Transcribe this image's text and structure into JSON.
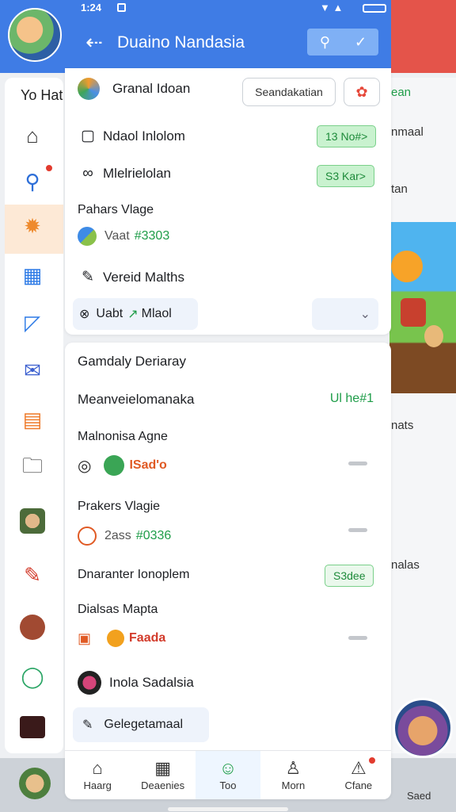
{
  "status_bar": {
    "time": "1:24"
  },
  "background": {
    "sidebar_title": "Yo Hat",
    "right_texts": [
      "ean",
      "nmaal",
      "tan",
      "nats",
      "nalas"
    ],
    "bottom_right_label": "Saed"
  },
  "header": {
    "title": "Duaino Nandasia"
  },
  "top_row": {
    "title": "Granal Idoan",
    "button": "Seandakatian"
  },
  "card1": {
    "row1": {
      "label": "Ndaol Inlolom",
      "pill": "13 No#>"
    },
    "row2": {
      "label": "Mlelrielolan",
      "pill": "S3 Kar>"
    },
    "section": "Pahars Vlage",
    "value": {
      "prefix": "Vaat",
      "num": "#3303"
    },
    "row3": {
      "label": "Vereid Malths"
    },
    "chip": {
      "text1": "Uabt",
      "text2": "Mlaol"
    }
  },
  "card2": {
    "title": "Gamdaly Deriaray",
    "row1": {
      "label": "Meanveielomanaka",
      "value": "Ul he#1"
    },
    "sec1": {
      "label": "Malnonisa Agne",
      "value": "ISad'o"
    },
    "sec2": {
      "label": "Prakers Vlagie",
      "value_a": "2ass",
      "value_b": "#0336"
    },
    "row2": {
      "label": "Dnaranter Ionoplem",
      "pill": "S3dee"
    },
    "sec3": {
      "label": "Dialsas Mapta",
      "value": "Faada"
    },
    "row3": {
      "label": "Inola Sadalsia"
    },
    "chip": {
      "label": "Gelegetamaal"
    }
  },
  "bottom_nav": {
    "items": [
      {
        "label": "Haarg",
        "icon": "home-icon"
      },
      {
        "label": "Deaenies",
        "icon": "grid-icon"
      },
      {
        "label": "Too",
        "icon": "face-icon"
      },
      {
        "label": "Morn",
        "icon": "person-icon"
      },
      {
        "label": "Cfane",
        "icon": "alert-icon"
      }
    ]
  }
}
